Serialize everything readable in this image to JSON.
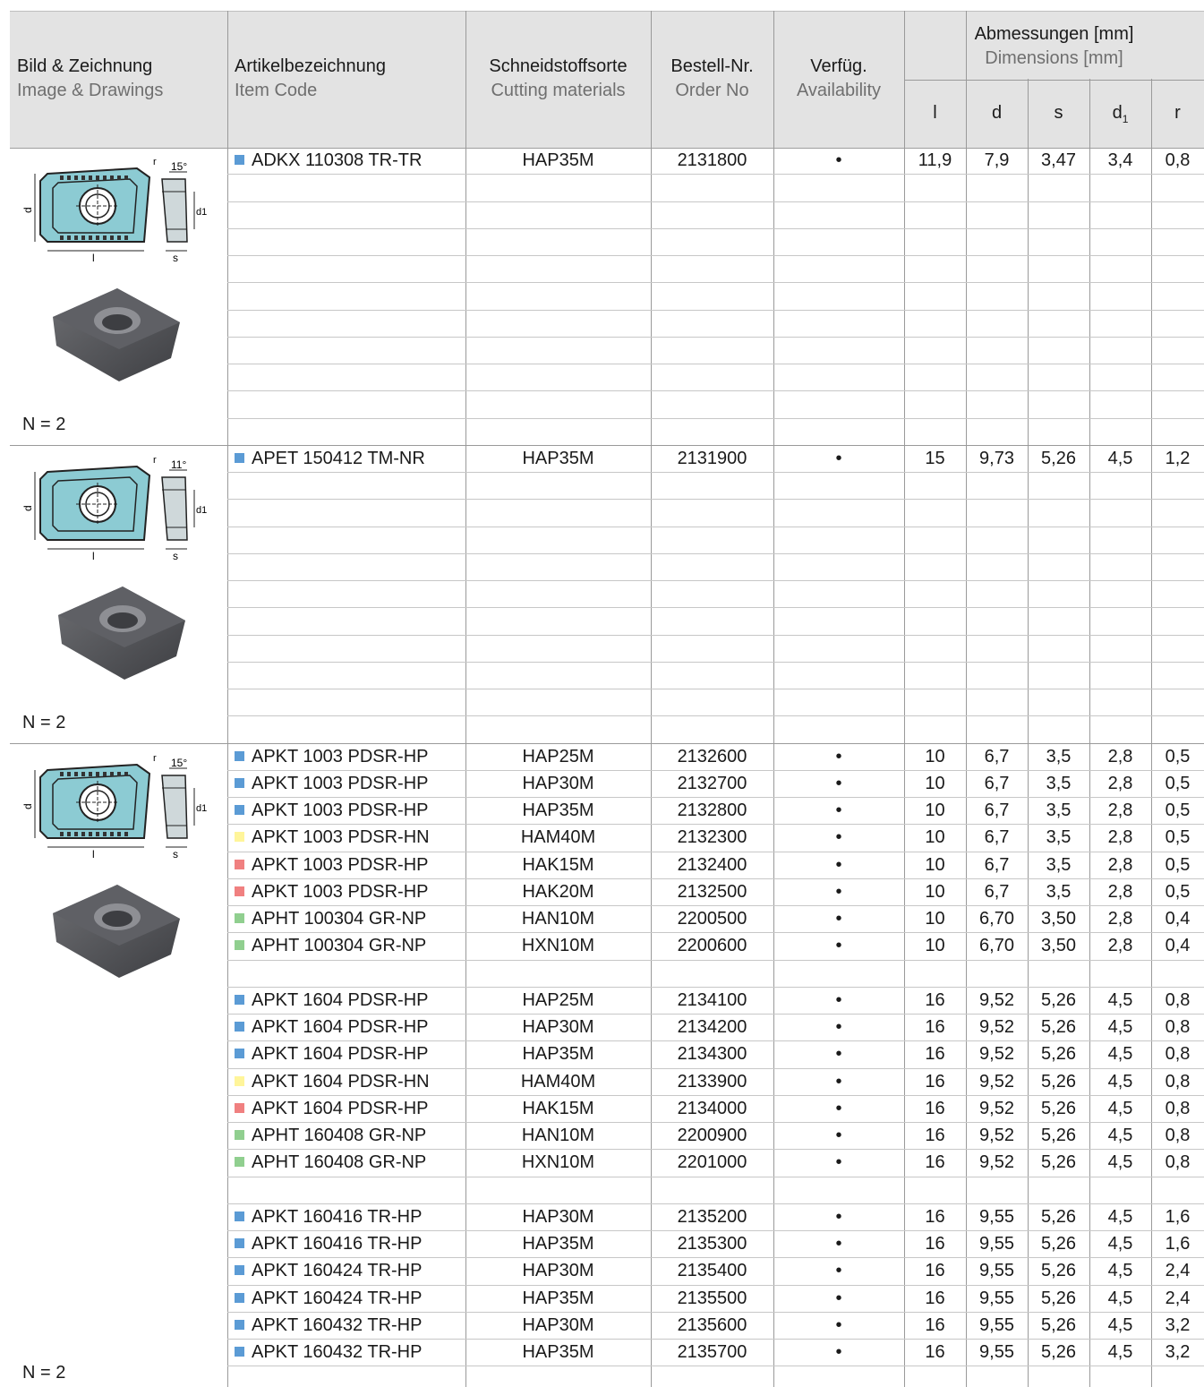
{
  "header": {
    "image": {
      "de": "Bild & Zeichnung",
      "en": "Image & Drawings"
    },
    "item": {
      "de": "Artikelbezeichnung",
      "en": "Item Code"
    },
    "material": {
      "de": "Schneidstoffsorte",
      "en": "Cutting materials"
    },
    "order": {
      "de": "Bestell-Nr.",
      "en": "Order No"
    },
    "avail": {
      "de": "Verfüg.",
      "en": "Availability"
    },
    "dims": {
      "de": "Abmessungen [mm]",
      "en": "Dimensions [mm]"
    },
    "dim_cols": [
      "l",
      "d",
      "s",
      "d1",
      "r"
    ]
  },
  "colors": {
    "blue": "#5b9bd5",
    "yellow": "#fff59a",
    "red": "#f08080",
    "green": "#90cf8f"
  },
  "groups": [
    {
      "n_label": "N = 2",
      "drawing": {
        "angle": "15°",
        "labels": [
          "d",
          "l",
          "r",
          "d1",
          "s"
        ],
        "style": "ribbed"
      },
      "rows": [
        {
          "color": "blue",
          "code": "ADKX 110308 TR-TR",
          "material": "HAP35M",
          "order": "2131800",
          "avail": "•",
          "l": "11,9",
          "d": "7,9",
          "s": "3,47",
          "d1": "3,4",
          "r": "0,8"
        },
        {},
        {},
        {},
        {},
        {},
        {},
        {},
        {},
        {},
        {}
      ]
    },
    {
      "n_label": "N = 2",
      "drawing": {
        "angle": "11°",
        "labels": [
          "d",
          "l",
          "r",
          "d1",
          "s"
        ],
        "style": "plain"
      },
      "rows": [
        {
          "color": "blue",
          "code": "APET 150412 TM-NR",
          "material": "HAP35M",
          "order": "2131900",
          "avail": "•",
          "l": "15",
          "d": "9,73",
          "s": "5,26",
          "d1": "4,5",
          "r": "1,2"
        },
        {},
        {},
        {},
        {},
        {},
        {},
        {},
        {},
        {},
        {}
      ]
    },
    {
      "n_label": "N = 2",
      "drawing": {
        "angle": "15°",
        "labels": [
          "d",
          "l",
          "r",
          "d1",
          "s"
        ],
        "style": "ribbed"
      },
      "rows": [
        {
          "color": "blue",
          "code": "APKT 1003 PDSR-HP",
          "material": "HAP25M",
          "order": "2132600",
          "avail": "•",
          "l": "10",
          "d": "6,7",
          "s": "3,5",
          "d1": "2,8",
          "r": "0,5"
        },
        {
          "color": "blue",
          "code": "APKT 1003 PDSR-HP",
          "material": "HAP30M",
          "order": "2132700",
          "avail": "•",
          "l": "10",
          "d": "6,7",
          "s": "3,5",
          "d1": "2,8",
          "r": "0,5"
        },
        {
          "color": "blue",
          "code": "APKT 1003 PDSR-HP",
          "material": "HAP35M",
          "order": "2132800",
          "avail": "•",
          "l": "10",
          "d": "6,7",
          "s": "3,5",
          "d1": "2,8",
          "r": "0,5"
        },
        {
          "color": "yellow",
          "code": "APKT 1003 PDSR-HN",
          "material": "HAM40M",
          "order": "2132300",
          "avail": "•",
          "l": "10",
          "d": "6,7",
          "s": "3,5",
          "d1": "2,8",
          "r": "0,5"
        },
        {
          "color": "red",
          "code": "APKT 1003 PDSR-HP",
          "material": "HAK15M",
          "order": "2132400",
          "avail": "•",
          "l": "10",
          "d": "6,7",
          "s": "3,5",
          "d1": "2,8",
          "r": "0,5"
        },
        {
          "color": "red",
          "code": "APKT 1003 PDSR-HP",
          "material": "HAK20M",
          "order": "2132500",
          "avail": "•",
          "l": "10",
          "d": "6,7",
          "s": "3,5",
          "d1": "2,8",
          "r": "0,5"
        },
        {
          "color": "green",
          "code": "APHT 100304 GR-NP",
          "material": "HAN10M",
          "order": "2200500",
          "avail": "•",
          "l": "10",
          "d": "6,70",
          "s": "3,50",
          "d1": "2,8",
          "r": "0,4"
        },
        {
          "color": "green",
          "code": "APHT 100304 GR-NP",
          "material": "HXN10M",
          "order": "2200600",
          "avail": "•",
          "l": "10",
          "d": "6,70",
          "s": "3,50",
          "d1": "2,8",
          "r": "0,4"
        },
        {},
        {
          "color": "blue",
          "code": "APKT 1604 PDSR-HP",
          "material": "HAP25M",
          "order": "2134100",
          "avail": "•",
          "l": "16",
          "d": "9,52",
          "s": "5,26",
          "d1": "4,5",
          "r": "0,8"
        },
        {
          "color": "blue",
          "code": "APKT 1604 PDSR-HP",
          "material": "HAP30M",
          "order": "2134200",
          "avail": "•",
          "l": "16",
          "d": "9,52",
          "s": "5,26",
          "d1": "4,5",
          "r": "0,8"
        },
        {
          "color": "blue",
          "code": "APKT 1604 PDSR-HP",
          "material": "HAP35M",
          "order": "2134300",
          "avail": "•",
          "l": "16",
          "d": "9,52",
          "s": "5,26",
          "d1": "4,5",
          "r": "0,8"
        },
        {
          "color": "yellow",
          "code": "APKT 1604 PDSR-HN",
          "material": "HAM40M",
          "order": "2133900",
          "avail": "•",
          "l": "16",
          "d": "9,52",
          "s": "5,26",
          "d1": "4,5",
          "r": "0,8"
        },
        {
          "color": "red",
          "code": "APKT 1604 PDSR-HP",
          "material": "HAK15M",
          "order": "2134000",
          "avail": "•",
          "l": "16",
          "d": "9,52",
          "s": "5,26",
          "d1": "4,5",
          "r": "0,8"
        },
        {
          "color": "green",
          "code": "APHT 160408 GR-NP",
          "material": "HAN10M",
          "order": "2200900",
          "avail": "•",
          "l": "16",
          "d": "9,52",
          "s": "5,26",
          "d1": "4,5",
          "r": "0,8"
        },
        {
          "color": "green",
          "code": "APHT 160408 GR-NP",
          "material": "HXN10M",
          "order": "2201000",
          "avail": "•",
          "l": "16",
          "d": "9,52",
          "s": "5,26",
          "d1": "4,5",
          "r": "0,8"
        },
        {},
        {
          "color": "blue",
          "code": "APKT 160416 TR-HP",
          "material": "HAP30M",
          "order": "2135200",
          "avail": "•",
          "l": "16",
          "d": "9,55",
          "s": "5,26",
          "d1": "4,5",
          "r": "1,6"
        },
        {
          "color": "blue",
          "code": "APKT 160416 TR-HP",
          "material": "HAP35M",
          "order": "2135300",
          "avail": "•",
          "l": "16",
          "d": "9,55",
          "s": "5,26",
          "d1": "4,5",
          "r": "1,6"
        },
        {
          "color": "blue",
          "code": "APKT 160424 TR-HP",
          "material": "HAP30M",
          "order": "2135400",
          "avail": "•",
          "l": "16",
          "d": "9,55",
          "s": "5,26",
          "d1": "4,5",
          "r": "2,4"
        },
        {
          "color": "blue",
          "code": "APKT 160424 TR-HP",
          "material": "HAP35M",
          "order": "2135500",
          "avail": "•",
          "l": "16",
          "d": "9,55",
          "s": "5,26",
          "d1": "4,5",
          "r": "2,4"
        },
        {
          "color": "blue",
          "code": "APKT 160432 TR-HP",
          "material": "HAP30M",
          "order": "2135600",
          "avail": "•",
          "l": "16",
          "d": "9,55",
          "s": "5,26",
          "d1": "4,5",
          "r": "3,2"
        },
        {
          "color": "blue",
          "code": "APKT 160432 TR-HP",
          "material": "HAP35M",
          "order": "2135700",
          "avail": "•",
          "l": "16",
          "d": "9,55",
          "s": "5,26",
          "d1": "4,5",
          "r": "3,2"
        },
        {}
      ]
    }
  ]
}
